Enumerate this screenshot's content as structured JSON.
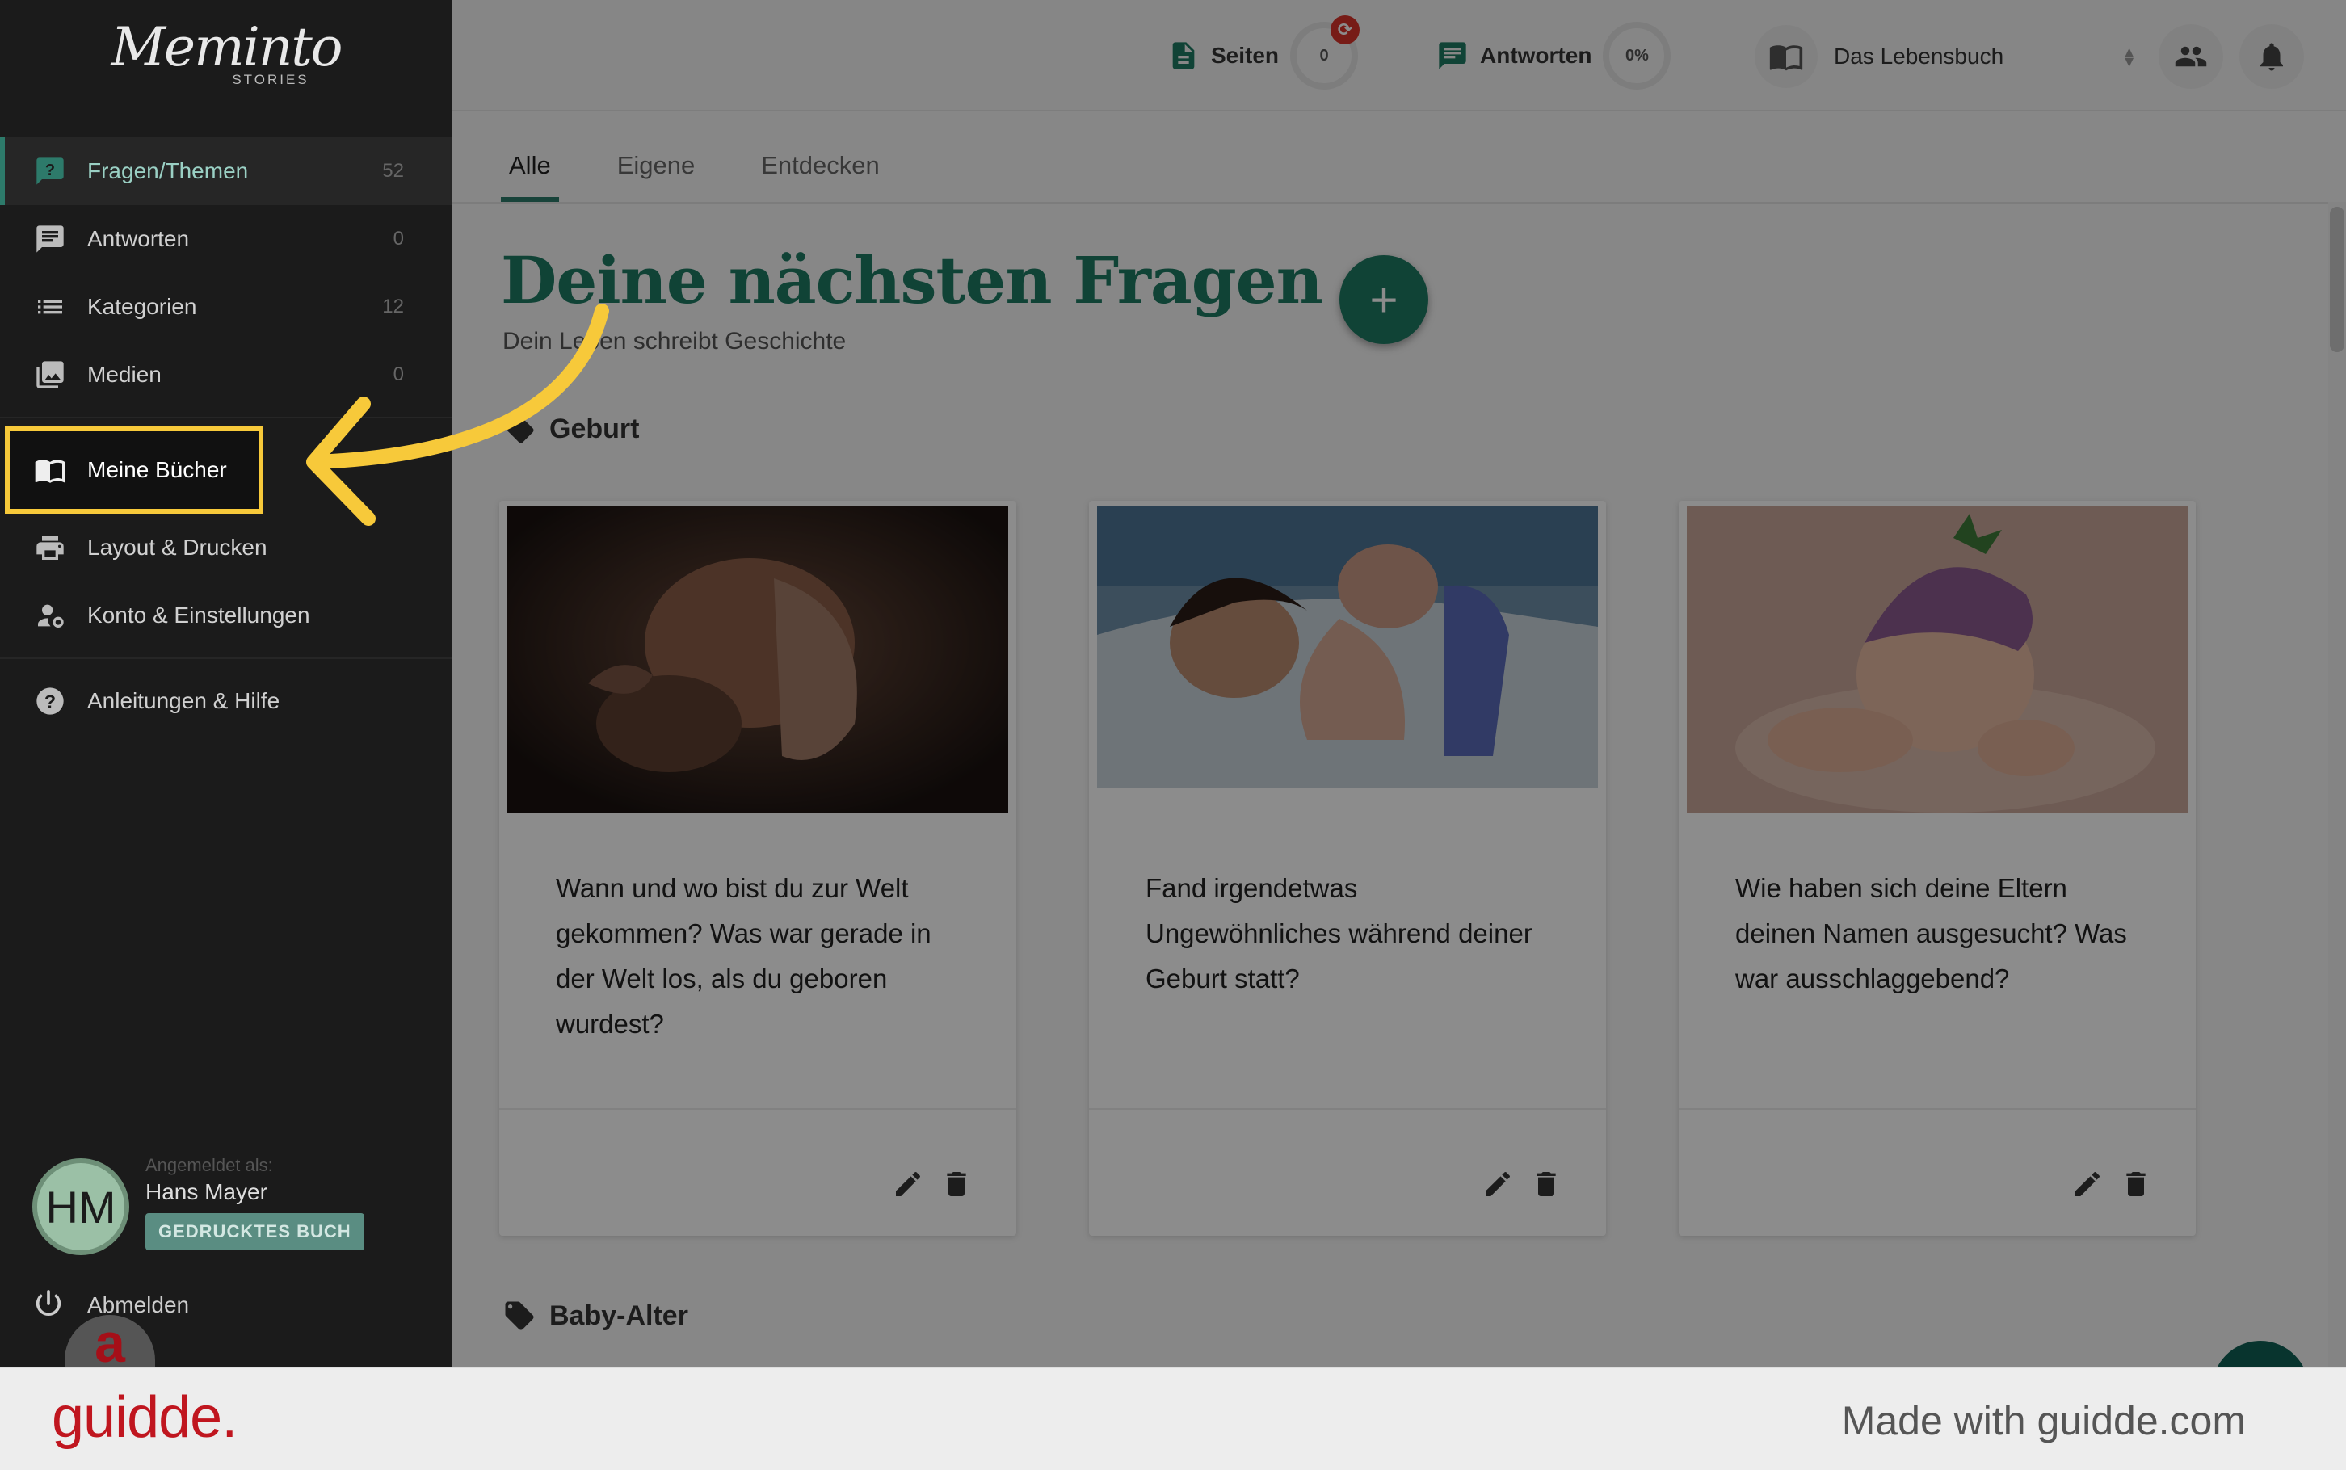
{
  "app": {
    "logo_text": "Meminto",
    "logo_sub": "STORIES"
  },
  "sidebar": {
    "items": [
      {
        "label": "Fragen/Themen",
        "count": "52",
        "icon": "question-icon"
      },
      {
        "label": "Antworten",
        "count": "0",
        "icon": "chat-icon"
      },
      {
        "label": "Kategorien",
        "count": "12",
        "icon": "list-icon"
      },
      {
        "label": "Medien",
        "count": "0",
        "icon": "photo-library-icon"
      },
      {
        "label": "Meine Bücher",
        "icon": "book-icon"
      },
      {
        "label": "Layout & Drucken",
        "icon": "printer-icon"
      },
      {
        "label": "Konto & Einstellungen",
        "icon": "person-settings-icon"
      },
      {
        "label": "Anleitungen & Hilfe",
        "icon": "help-icon"
      }
    ],
    "user": {
      "initials": "HM",
      "logged_in_label": "Angemeldet als:",
      "name": "Hans Mayer",
      "badge": "GEDRUCKTES BUCH"
    },
    "logout_label": "Abmelden"
  },
  "topbar": {
    "pages_label": "Seiten",
    "pages_value": "0",
    "answers_label": "Antworten",
    "answers_value": "0%",
    "book_name": "Das Lebensbuch"
  },
  "tabs": [
    "Alle",
    "Eigene",
    "Entdecken"
  ],
  "main": {
    "heading": "Deine nächsten Fragen",
    "subheading": "Dein Leben schreibt Geschichte",
    "sections": [
      "Geburt",
      "Baby-Alter"
    ],
    "cards": [
      {
        "question": "Wann und wo bist du zur Welt gekommen? Was war gerade in der Welt los, als du geboren wurdest?"
      },
      {
        "question": "Fand irgendetwas Ungewöhnliches während deiner Geburt statt?"
      },
      {
        "question": "Wie haben sich deine Eltern deinen Namen ausgesucht? Was war ausschlaggebend?"
      }
    ]
  },
  "footer": {
    "brand": "guidde.",
    "made_with": "Made with guidde.com"
  },
  "colors": {
    "accent": "#1e7a63",
    "highlight": "#f7c93a",
    "sidebar_bg": "#1b1b1b",
    "brand_red": "#c0161f"
  }
}
